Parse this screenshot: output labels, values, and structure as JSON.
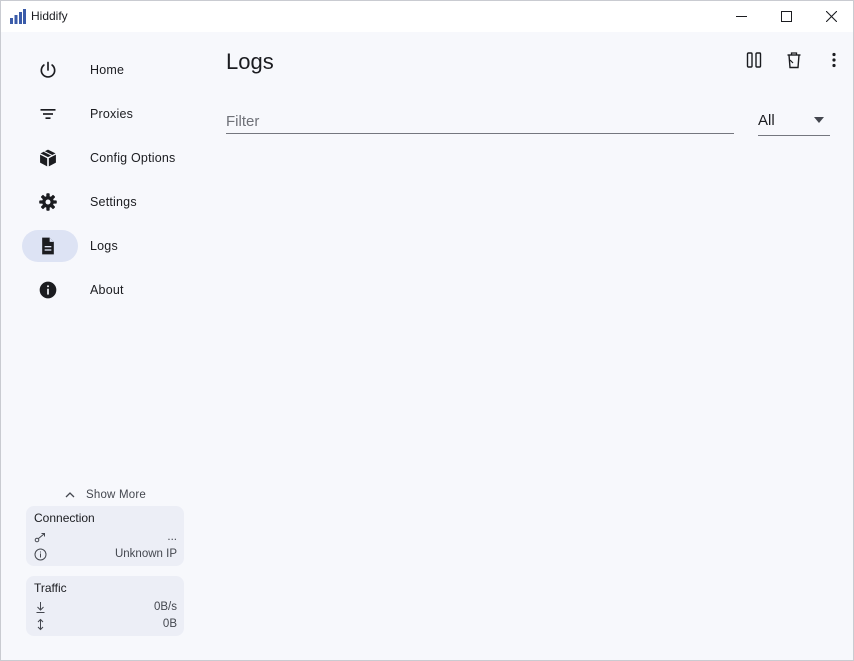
{
  "window": {
    "title": "Hiddify"
  },
  "sidebar": {
    "items": [
      {
        "label": "Home",
        "icon": "power-icon",
        "active": false
      },
      {
        "label": "Proxies",
        "icon": "filter-list-icon",
        "active": false
      },
      {
        "label": "Config Options",
        "icon": "box-icon",
        "active": false
      },
      {
        "label": "Settings",
        "icon": "gear-icon",
        "active": false
      },
      {
        "label": "Logs",
        "icon": "document-icon",
        "active": true
      },
      {
        "label": "About",
        "icon": "info-icon",
        "active": false
      }
    ],
    "show_more_label": "Show More",
    "connection": {
      "title": "Connection",
      "status_value": "...",
      "ip_value": "Unknown IP"
    },
    "traffic": {
      "title": "Traffic",
      "speed_value": "0B/s",
      "total_value": "0B"
    }
  },
  "main": {
    "title": "Logs",
    "filter_placeholder": "Filter",
    "level_value": "All"
  },
  "colors": {
    "accent": "#3a5ba9",
    "active_pill": "#dde3f4",
    "background": "#f7f8fc"
  }
}
